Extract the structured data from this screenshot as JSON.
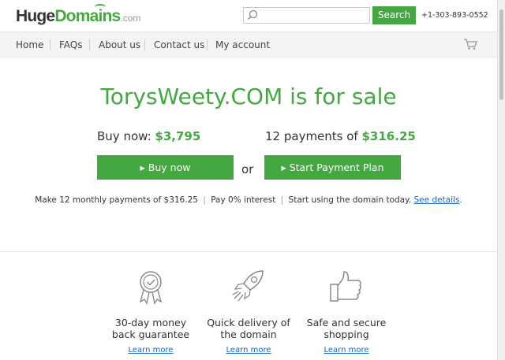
{
  "header": {
    "logo_huge": "Huge",
    "logo_domains": "Domains",
    "logo_dotcom": ".com",
    "search_placeholder": "",
    "search_label": "Search",
    "phone": "+1-303-893-0552"
  },
  "nav": {
    "items": [
      {
        "label": "Home"
      },
      {
        "label": "FAQs"
      },
      {
        "label": "About us"
      },
      {
        "label": "Contact us"
      },
      {
        "label": "My account"
      }
    ],
    "cart_icon": "cart-icon"
  },
  "hero": {
    "title": "TorysWeety.COM is for sale",
    "buy_now_label": "Buy now:",
    "buy_now_price": "$3,795",
    "payments_label": "12 payments of",
    "payments_price": "$316.25",
    "buy_button": "▸ Buy now",
    "or_text": "or",
    "plan_button": "▸ Start Payment Plan",
    "payline_part1": "Make 12 monthly payments of $316.25",
    "payline_sep": "|",
    "payline_part2": "Pay 0% interest",
    "payline_part3": "Start using the domain today.",
    "see_details": "See details",
    "payline_end": "."
  },
  "features": [
    {
      "icon": "award-ribbon-icon",
      "line1": "30-day money",
      "line2": "back guarantee",
      "link": "Learn more"
    },
    {
      "icon": "rocket-icon",
      "line1": "Quick delivery of",
      "line2": "the domain",
      "link": "Learn more"
    },
    {
      "icon": "thumbs-up-icon",
      "line1": "Safe and secure",
      "line2": "shopping",
      "link": "Learn more"
    }
  ],
  "colors": {
    "accent_green": "#43a840",
    "link_blue": "#1a66c9"
  }
}
